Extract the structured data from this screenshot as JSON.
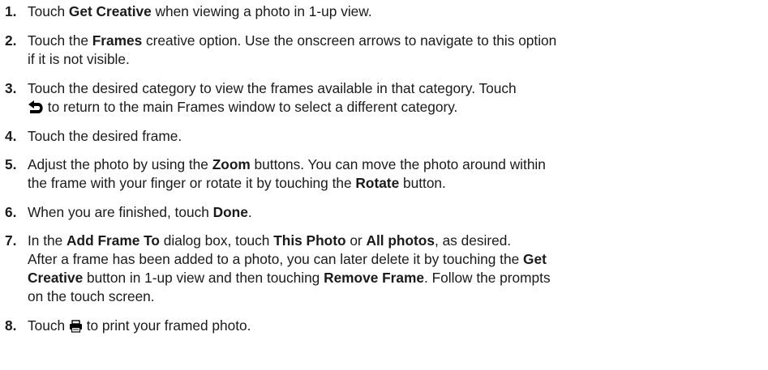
{
  "steps": [
    {
      "number": "1.",
      "lines": [
        [
          {
            "t": "Touch "
          },
          {
            "t": "Get Creative",
            "b": true
          },
          {
            "t": " when viewing a photo in 1-up view."
          }
        ]
      ]
    },
    {
      "number": "2.",
      "lines": [
        [
          {
            "t": "Touch the "
          },
          {
            "t": "Frames",
            "b": true
          },
          {
            "t": " creative option. Use the onscreen arrows to navigate to this option"
          }
        ],
        [
          {
            "t": "if it is not visible."
          }
        ]
      ]
    },
    {
      "number": "3.",
      "lines": [
        [
          {
            "t": "Touch the desired category to view the frames available in that category. Touch"
          }
        ],
        [
          {
            "icon": "back-arrow-icon"
          },
          {
            "t": " to return to the main Frames window to select a different category."
          }
        ]
      ]
    },
    {
      "number": "4.",
      "lines": [
        [
          {
            "t": "Touch the desired frame."
          }
        ]
      ]
    },
    {
      "number": "5.",
      "lines": [
        [
          {
            "t": "Adjust the photo by using the "
          },
          {
            "t": "Zoom",
            "b": true
          },
          {
            "t": " buttons. You can move the photo around within"
          }
        ],
        [
          {
            "t": "the frame with your finger or rotate it by touching the "
          },
          {
            "t": "Rotate",
            "b": true
          },
          {
            "t": " button."
          }
        ]
      ]
    },
    {
      "number": "6.",
      "lines": [
        [
          {
            "t": "When you are finished, touch "
          },
          {
            "t": "Done",
            "b": true
          },
          {
            "t": "."
          }
        ]
      ]
    },
    {
      "number": "7.",
      "lines": [
        [
          {
            "t": "In the "
          },
          {
            "t": "Add Frame To",
            "b": true
          },
          {
            "t": " dialog box, touch "
          },
          {
            "t": "This Photo",
            "b": true
          },
          {
            "t": " or "
          },
          {
            "t": "All photos",
            "b": true
          },
          {
            "t": ", as desired."
          }
        ],
        [
          {
            "t": "After a frame has been added to a photo, you can later delete it by touching the "
          },
          {
            "t": "Get",
            "b": true
          }
        ],
        [
          {
            "t": "Creative",
            "b": true
          },
          {
            "t": " button in 1-up view and then touching "
          },
          {
            "t": "Remove Frame",
            "b": true
          },
          {
            "t": ". Follow the prompts"
          }
        ],
        [
          {
            "t": "on the touch screen."
          }
        ]
      ]
    },
    {
      "number": "8.",
      "lines": [
        [
          {
            "t": "Touch "
          },
          {
            "icon": "print-icon"
          },
          {
            "t": " to print your framed photo."
          }
        ]
      ]
    }
  ]
}
